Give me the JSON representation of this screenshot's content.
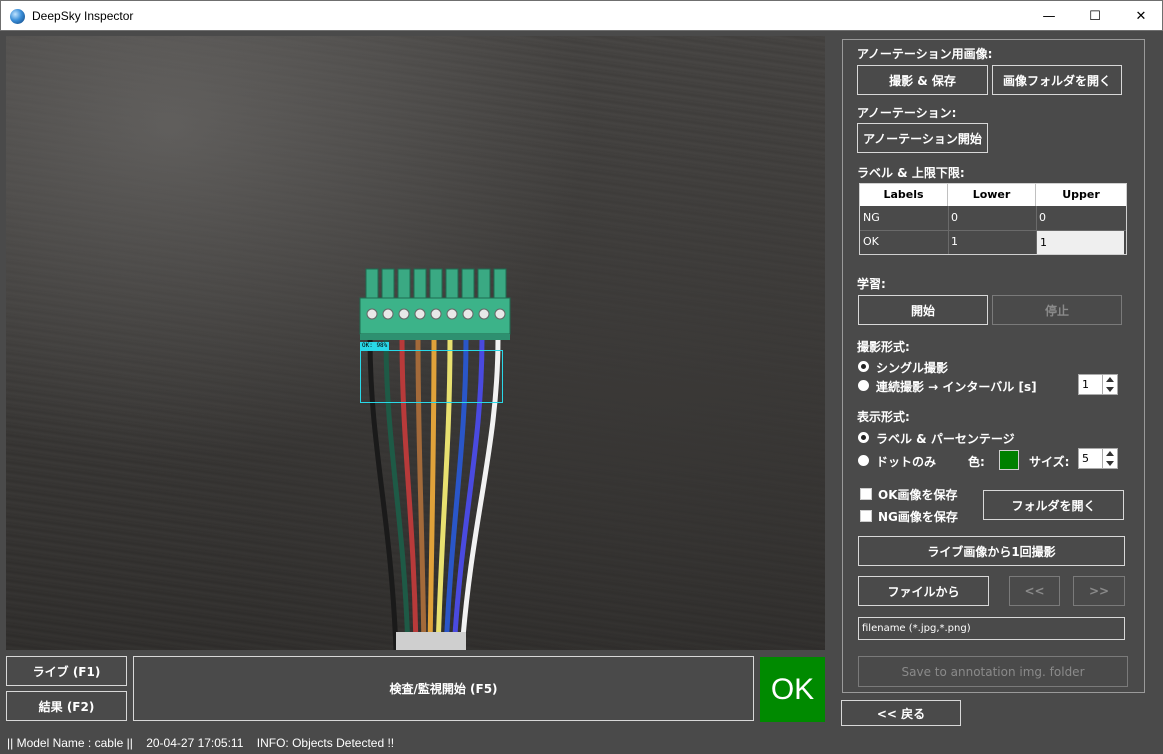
{
  "window": {
    "title": "DeepSky Inspector",
    "min": "—",
    "max": "☐",
    "close": "✕"
  },
  "camera": {
    "detection_label": "OK: 98%"
  },
  "bottom": {
    "live_label": "ライブ (F1)",
    "result_label": "結果 (F2)",
    "inspect_label": "検査/監視開始 (F5)",
    "ok_text": "OK"
  },
  "status": {
    "model": "|| Model Name : cable ||",
    "time": "20-04-27 17:05:11",
    "info": "INFO:   Objects Detected !!"
  },
  "panel": {
    "annotation_images_label": "アノーテーション用画像:",
    "capture_save_label": "撮影 & 保存",
    "open_image_folder_label": "画像フォルダを開く",
    "annotation_label": "アノーテーション:",
    "start_annotation_label": "アノーテーション開始",
    "label_limits_label": "ラベル & 上限下限:",
    "grid": {
      "headers": [
        "Labels",
        "Lower",
        "Upper"
      ],
      "rows": [
        {
          "label": "NG",
          "lower": "0",
          "upper": "0"
        },
        {
          "label": "OK",
          "lower": "1",
          "upper": "1"
        }
      ]
    },
    "learning_label": "学習:",
    "start_label": "開始",
    "stop_label": "停止",
    "capture_mode_label": "撮影形式:",
    "single_capture_label": "シングル撮影",
    "continuous_capture_label": "連続撮影 → インターバル [s]",
    "interval_value": "1",
    "display_mode_label": "表示形式:",
    "label_percent_label": "ラベル & パーセンテージ",
    "dots_only_label": "ドットのみ",
    "color_label": "色:",
    "size_label": "サイズ:",
    "size_value": "5",
    "save_ok_label": "OK画像を保存",
    "save_ng_label": "NG画像を保存",
    "open_folder_label": "フォルダを開く",
    "capture_once_label": "ライブ画像から1回撮影",
    "from_file_label": "ファイルから",
    "prev_label": "<<",
    "next_label": ">>",
    "filename_placeholder": "filename (*.jpg,*.png)",
    "save_annotation_label": "Save to annotation img. folder",
    "back_label": "<< 戻る"
  },
  "colors": {
    "ok_green": "#008a00",
    "swatch": "#008000",
    "detect_box": "#29d8e8"
  }
}
